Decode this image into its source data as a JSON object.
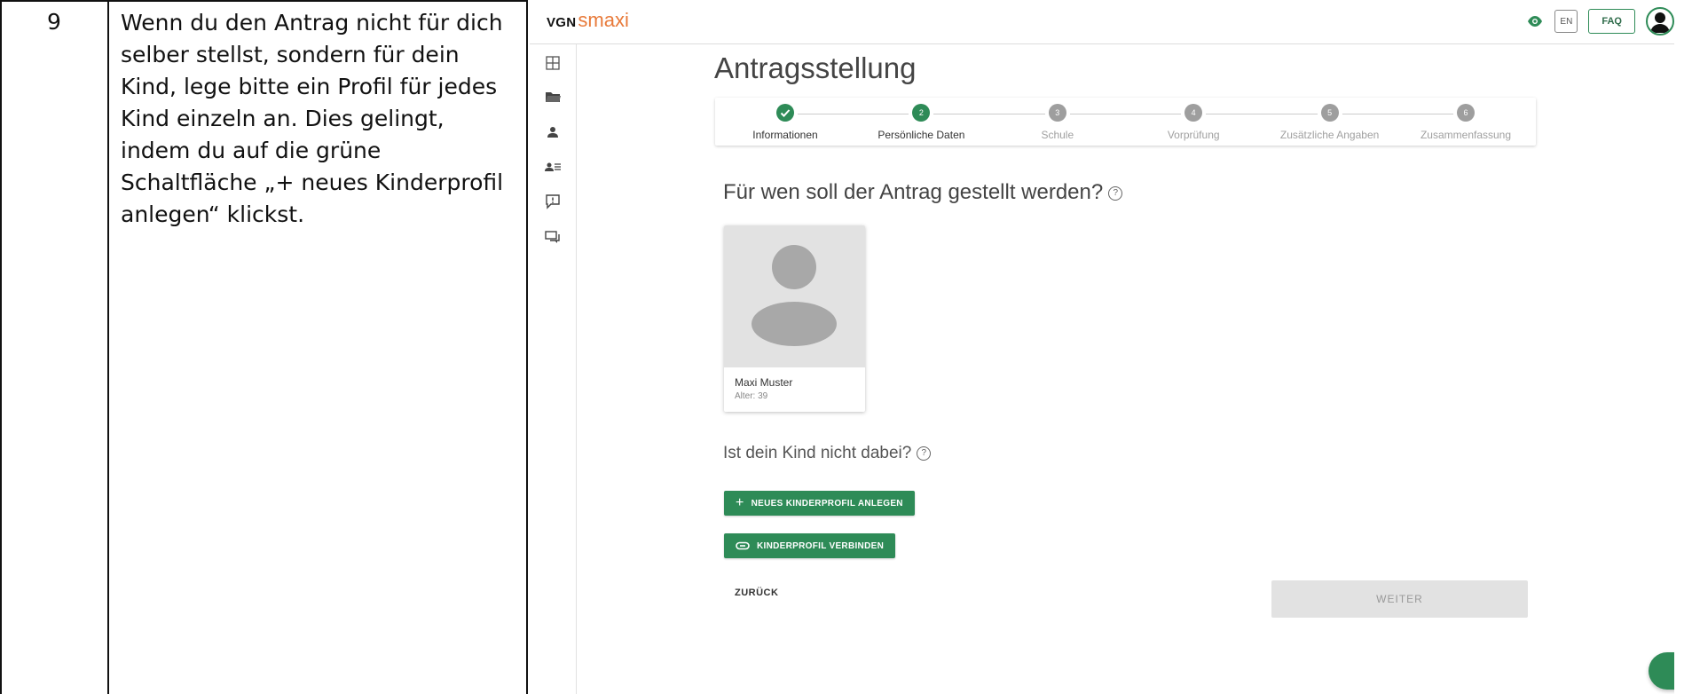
{
  "row": {
    "number": "9",
    "instruction_lines": [
      "Wenn du den Antrag nicht für dich",
      "selber stellst, sondern für dein",
      "Kind, lege bitte ein Profil für jedes",
      "Kind einzeln an. Dies gelingt,",
      "indem du auf die grüne",
      "Schaltfläche „+ neues Kinderprofil",
      "anlegen“ klickst."
    ]
  },
  "app": {
    "logo": {
      "brand": "VGN",
      "product": "smaxi"
    },
    "topbar": {
      "language": "EN",
      "faq": "FAQ"
    },
    "title": "Antragsstellung",
    "steps": [
      {
        "number": "",
        "label": "Informationen",
        "state": "done"
      },
      {
        "number": "2",
        "label": "Persönliche Daten",
        "state": "active"
      },
      {
        "number": "3",
        "label": "Schule",
        "state": "pending"
      },
      {
        "number": "4",
        "label": "Vorprüfung",
        "state": "pending"
      },
      {
        "number": "5",
        "label": "Zusätzliche Angaben",
        "state": "pending"
      },
      {
        "number": "6",
        "label": "Zusammenfassung",
        "state": "pending"
      }
    ],
    "question": "Für wen soll der Antrag gestellt werden?",
    "profile": {
      "name": "Maxi Muster",
      "age": "Alter: 39"
    },
    "subquestion": "Ist dein Kind nicht dabei?",
    "buttons": {
      "new_child": "NEUES KINDERPROFIL ANLEGEN",
      "connect_child": "KINDERPROFIL VERBINDEN",
      "back": "ZURÜCK",
      "next": "WEITER"
    }
  },
  "colors": {
    "primary_green": "#2e8b57",
    "logo_orange": "#e87a3a",
    "pending_step": "#9e9e9e",
    "disabled_button": "#e2e2e2"
  }
}
